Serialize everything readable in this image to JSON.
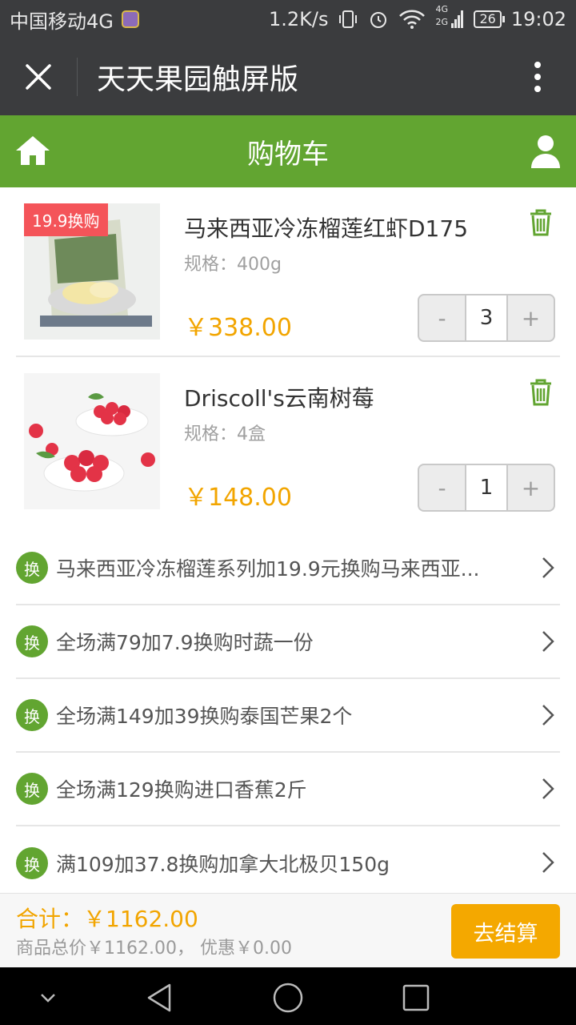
{
  "status_bar": {
    "carrier": "中国移动4G",
    "speed": "1.2K/s",
    "battery": "26",
    "time": "19:02",
    "network_badge_top": "4G",
    "network_badge_bottom": "2G"
  },
  "titlebar": {
    "title": "天天果园触屏版",
    "close_icon": "close-icon",
    "more_icon": "more-vertical-icon"
  },
  "header": {
    "title": "购物车",
    "home_icon": "home-icon",
    "user_icon": "user-icon",
    "color": "#62a531"
  },
  "cart": {
    "items": [
      {
        "badge": "19.9换购",
        "name": "马来西亚冷冻榴莲红虾D175",
        "spec": "规格：400g",
        "price": "￥338.00",
        "qty": "3",
        "minus": "-",
        "plus": "+"
      },
      {
        "badge": "",
        "name": "Driscoll's云南树莓",
        "spec": "规格：4盒",
        "price": "￥148.00",
        "qty": "1",
        "minus": "-",
        "plus": "+"
      }
    ]
  },
  "promotions": {
    "badge": "换",
    "items": [
      "马来西亚冷冻榴莲系列加19.9元换购马来西亚...",
      "全场满79加7.9换购时蔬一份",
      "全场满149加39换购泰国芒果2个",
      "全场满129换购进口香蕉2斤",
      "满109加37.8换购加拿大北极贝150g"
    ]
  },
  "summary": {
    "total": "合计：￥1162.00",
    "detail": "商品总价￥1162.00， 优惠￥0.00",
    "checkout": "去结算",
    "accent": "#f4a800"
  }
}
